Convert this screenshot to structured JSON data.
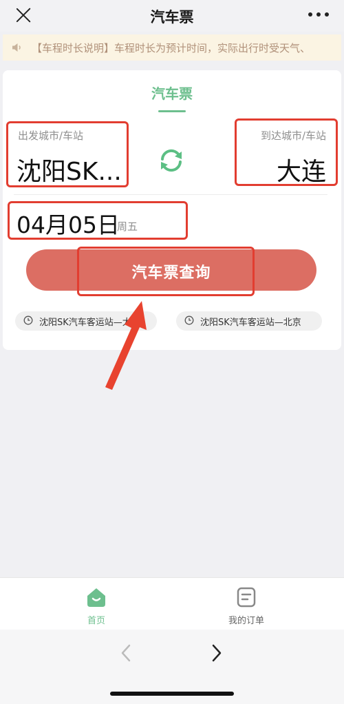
{
  "header": {
    "title": "汽车票"
  },
  "notice": {
    "text": "【车程时长说明】车程时长为预计时间，实际出行时受天气、"
  },
  "tab": {
    "title": "汽车票"
  },
  "departure": {
    "label": "出发城市/车站",
    "value": "沈阳SK..."
  },
  "arrival": {
    "label": "到达城市/车站",
    "value": "大连"
  },
  "date": {
    "value": "04月05日",
    "weekday": "周五"
  },
  "search": {
    "label": "汽车票查询"
  },
  "history": [
    {
      "text": "沈阳SK汽车客运站—大连"
    },
    {
      "text": "沈阳SK汽车客运站—北京"
    }
  ],
  "bottom_nav": [
    {
      "label": "首页",
      "icon": "home-icon",
      "active": true
    },
    {
      "label": "我的订单",
      "icon": "orders-icon",
      "active": false
    }
  ],
  "colors": {
    "accent_green": "#6dbf8e",
    "search_button": "#dc6e63",
    "annotation_red": "#e23d30"
  }
}
